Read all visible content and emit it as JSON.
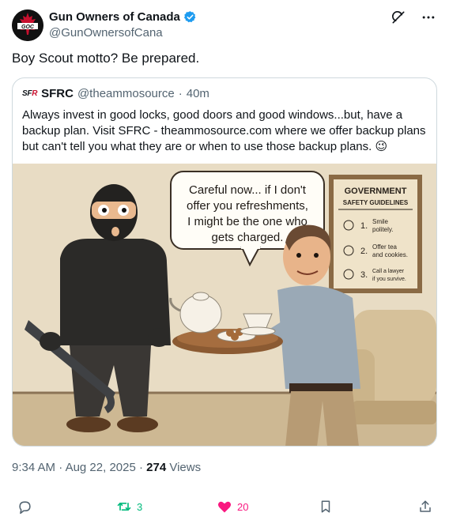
{
  "author": {
    "name": "Gun Owners of Canada",
    "handle": "@GunOwnersofCana",
    "avatar_text": "GOC"
  },
  "post": {
    "text": "Boy Scout motto? Be prepared."
  },
  "quote": {
    "logo_text_1": "SF",
    "logo_text_2": "R",
    "name": "SFRC",
    "handle": "@theammosource",
    "sep": "·",
    "time": "40m",
    "body": "Always invest in good locks, good doors and good windows...but, have a backup plan. Visit SFRC - theammosource.com where we offer backup plans but can't tell you what they are or when to use those backup plans. 😉",
    "image": {
      "bubble_lines": [
        "Careful now... if I don't",
        "offer you refreshments,",
        "I might be the one who",
        "gets charged."
      ],
      "sign_title_1": "GOVERNMENT",
      "sign_title_2": "SAFETY GUIDELINES",
      "sign_items": [
        {
          "num": "1.",
          "line1": "Smile",
          "line2": "politely."
        },
        {
          "num": "2.",
          "line1": "Offer tea",
          "line2": "and cookies."
        },
        {
          "num": "3.",
          "line1": "Call a lawyer",
          "line2": "if you survive."
        }
      ]
    }
  },
  "meta": {
    "time": "9:34 AM",
    "date": "Aug 22, 2025",
    "views_count": "274",
    "views_label": "Views"
  },
  "actions": {
    "reposts": "3",
    "likes": "20"
  },
  "colors": {
    "repost": "#00ba7c",
    "like": "#f91880",
    "verified": "#1d9bf0",
    "muted": "#536471"
  }
}
